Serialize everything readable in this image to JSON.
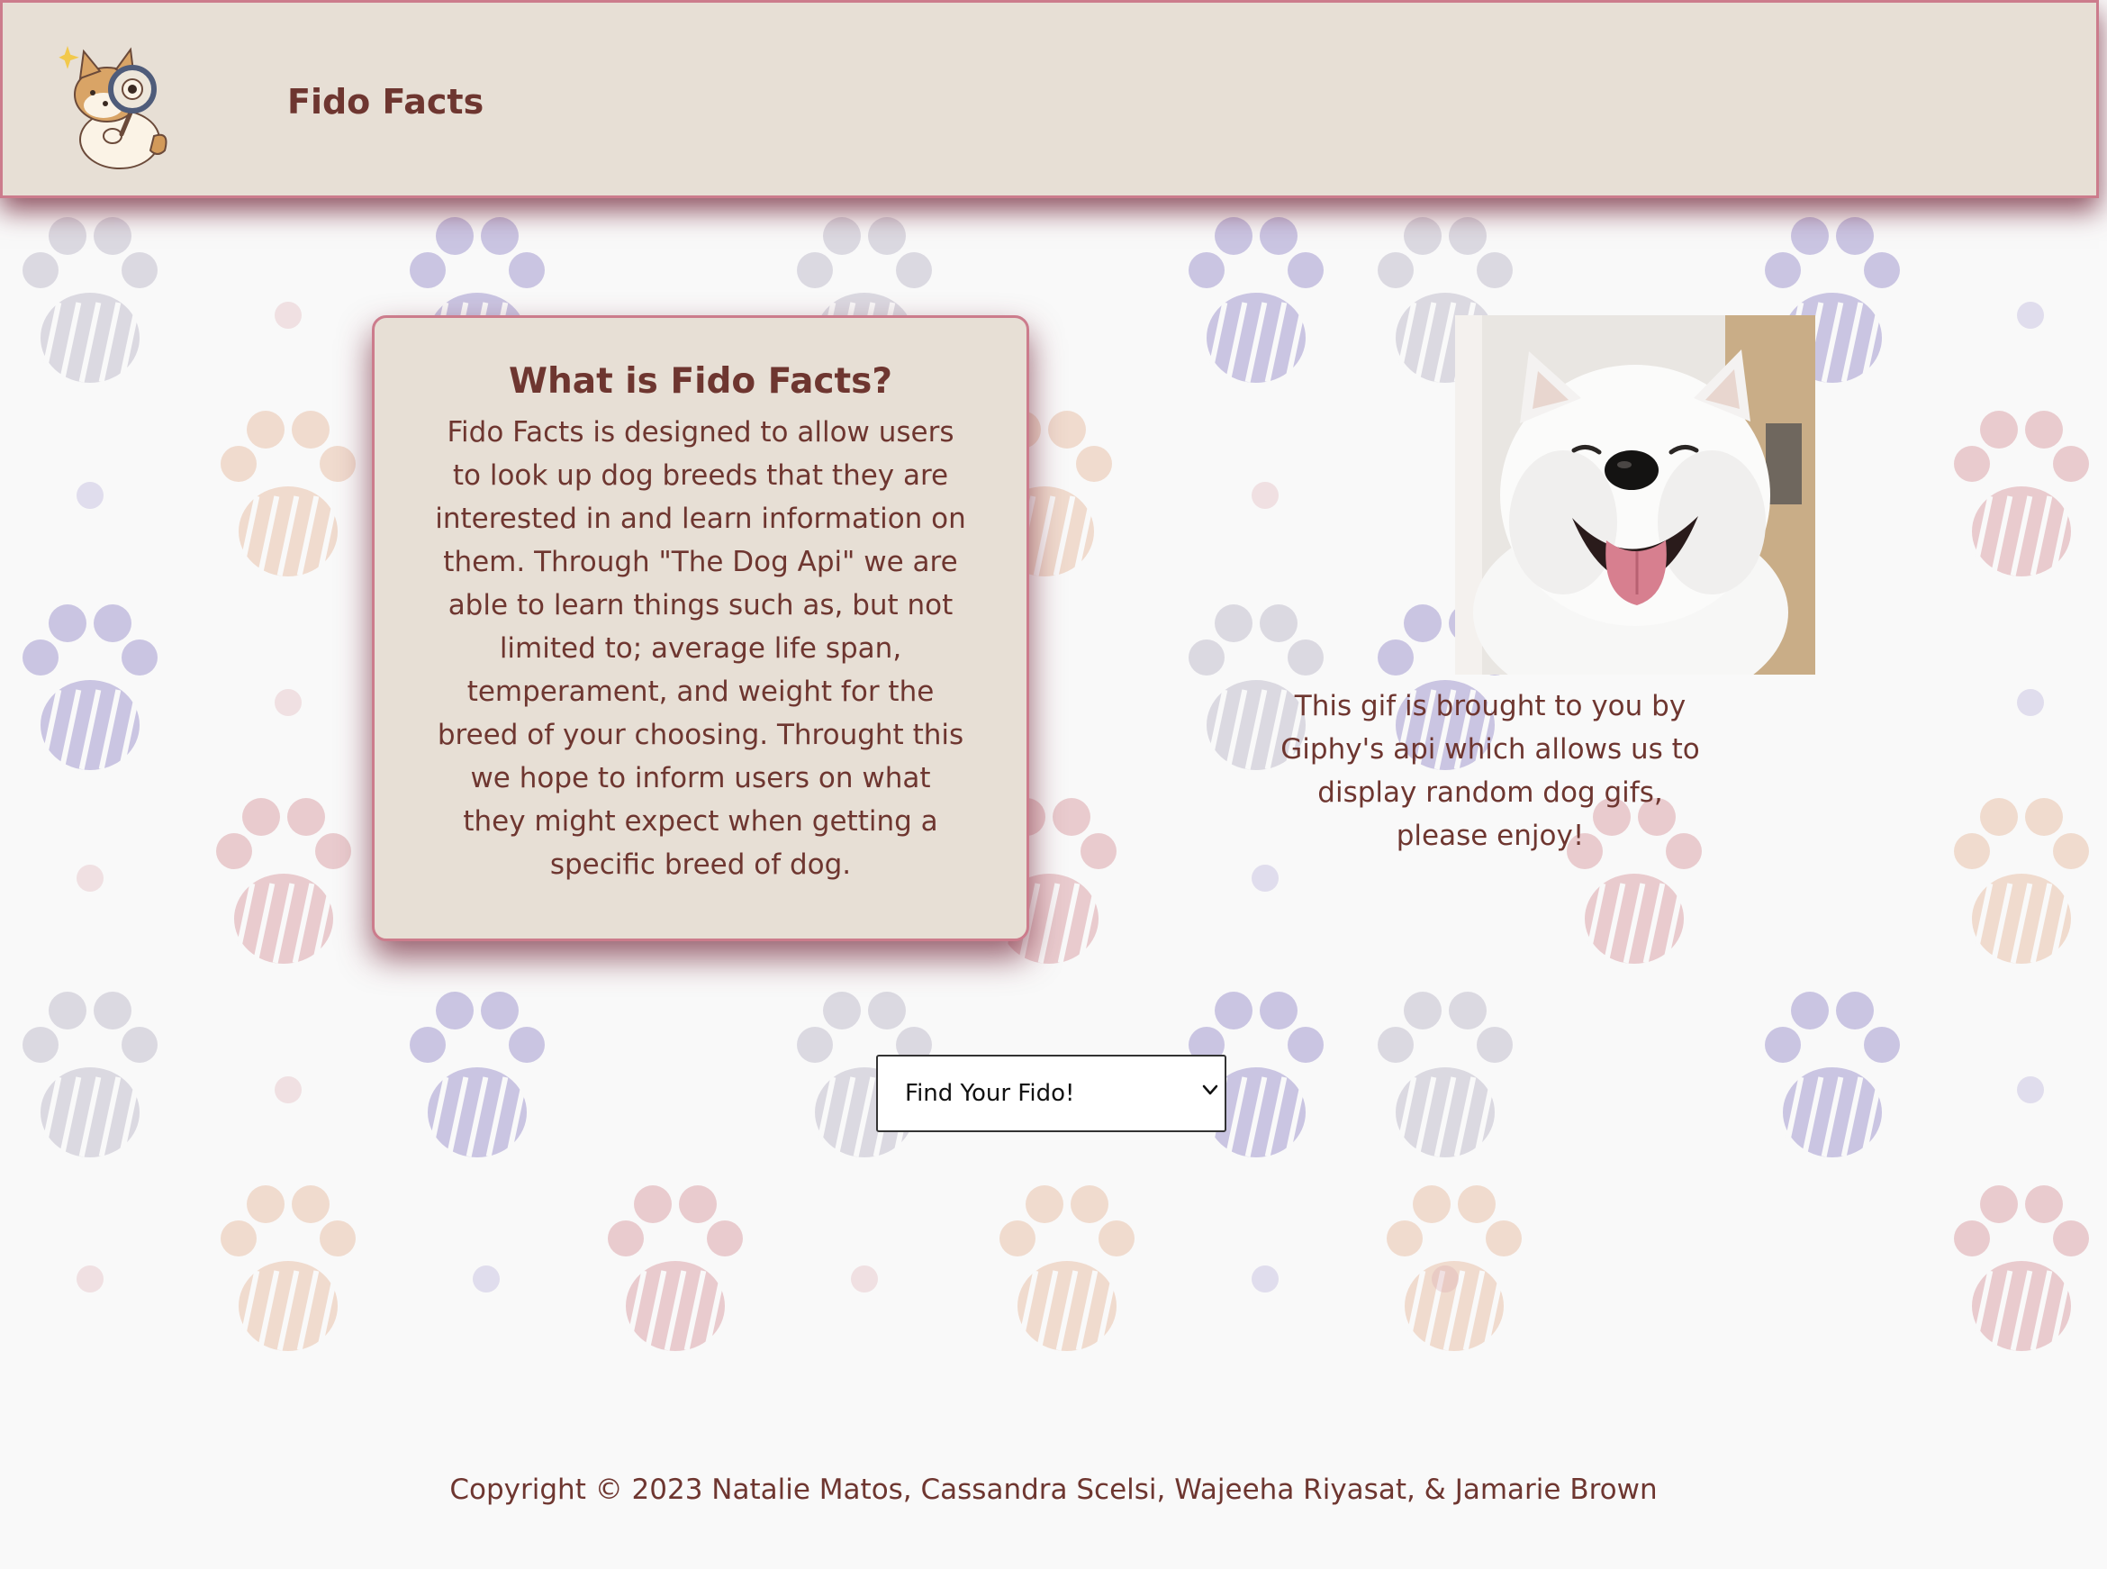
{
  "header": {
    "title": "Fido Facts",
    "logo_icon": "detective-dog-magnifier-icon"
  },
  "about": {
    "heading": "What is Fido Facts?",
    "body": "Fido Facts is designed to allow users to look up dog breeds that they are interested in and learn information on them. Through \"The Dog Api\" we are able to learn things such as, but not limited to; average life span, temperament, and weight for the breed of your choosing. Throught this we hope to inform users on what they might expect when getting a specific breed of dog."
  },
  "gif": {
    "image_icon": "smiling-white-samoyed-image",
    "caption": "This gif is brought to you by Giphy's api which allows us to display random dog gifs, please enjoy!"
  },
  "breed_select": {
    "selected": "Find Your Fido!",
    "options": [
      "Find Your Fido!"
    ]
  },
  "footer": {
    "copyright": "Copyright © 2023 Natalie Matos, Cassandra Scelsi, Wajeeha Riyasat, & Jamarie Brown"
  },
  "colors": {
    "header_bg": "#e7dfd5",
    "border_accent": "#cc7c8c",
    "text": "#6e3630",
    "page_bg": "#f9f9f9",
    "paw_purple": "#a49bd1",
    "paw_gray": "#c3c0cf",
    "paw_peach": "#e9c3ac",
    "paw_pink": "#dca7ac"
  }
}
